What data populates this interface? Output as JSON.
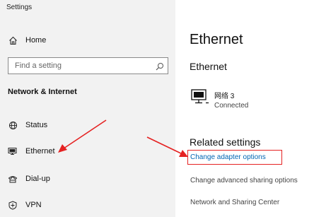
{
  "window": {
    "title": "Settings"
  },
  "sidebar": {
    "home": {
      "label": "Home",
      "icon": "home-icon"
    },
    "search": {
      "placeholder": "Find a setting",
      "icon": "search-icon"
    },
    "section_title": "Network & Internet",
    "items": [
      {
        "label": "Status",
        "icon": "globe-status-icon"
      },
      {
        "label": "Ethernet",
        "icon": "ethernet-icon"
      },
      {
        "label": "Dial-up",
        "icon": "dialup-phone-icon"
      },
      {
        "label": "VPN",
        "icon": "vpn-icon"
      }
    ]
  },
  "main": {
    "title": "Ethernet",
    "subtitle": "Ethernet",
    "network": {
      "name": "网络 3",
      "status": "Connected",
      "icon": "network-computer-icon"
    },
    "related_title": "Related settings",
    "links": [
      "Change adapter options",
      "Change advanced sharing options",
      "Network and Sharing Center"
    ]
  },
  "annotations": {
    "arrow_color": "#e52222",
    "highlight_color": "#e52222"
  },
  "colors": {
    "sidebar_bg": "#f2f2f2",
    "link": "#0066b4"
  }
}
